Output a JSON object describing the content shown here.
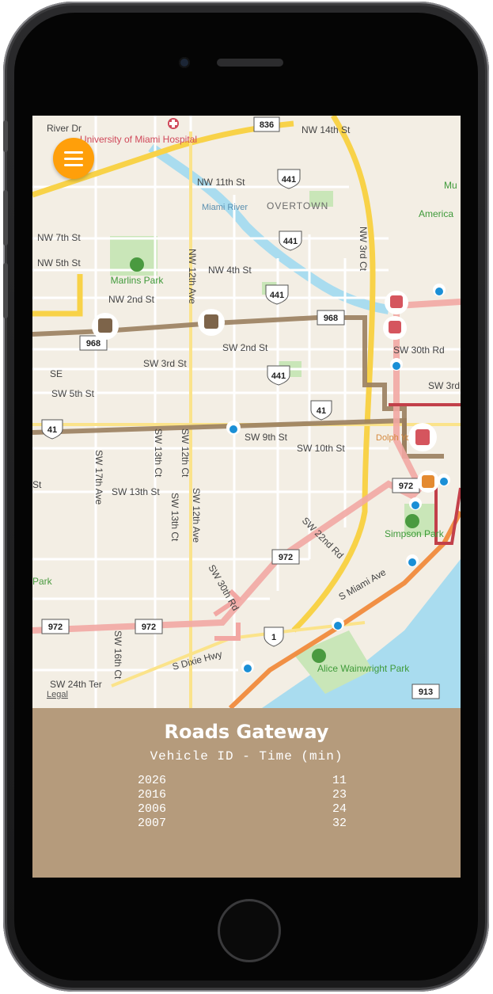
{
  "map": {
    "street_labels": [
      "NW 14th St",
      "NW 11th St",
      "OVERTOWN",
      "Miami River",
      "NW 7th St",
      "NW 5th St",
      "NW 4th St",
      "NW 2nd St",
      "SW 2nd St",
      "SW 3rd St",
      "SW 5th St",
      "SW 9th St",
      "SW 10th St",
      "SW 13th St",
      "NW 3rd Ct",
      "NW 12th Ave",
      "SW 17th Ave",
      "SW 13th Ct",
      "SW 12th Ct",
      "SW 12th Ave",
      "SW 30th Rd",
      "SW 22nd Rd",
      "S Miami Ave",
      "S Dixie Hwy",
      "SW 16th Ct",
      "SW 24th Ter",
      "SW 3rd St",
      "SE",
      "River Dr",
      "St",
      "Park"
    ],
    "places": [
      "University of Miami Hospital",
      "Marlins Park",
      "Simpson Park",
      "Alice Wainwright Park",
      "Dolph Your Ca",
      "America",
      "Mu",
      "Legal"
    ],
    "shields": [
      "836",
      "441",
      "441",
      "441",
      "441",
      "968",
      "968",
      "41",
      "41",
      "972",
      "972",
      "972",
      "972",
      "1",
      "913"
    ],
    "legal": "Legal"
  },
  "menu": {
    "icon": "hamburger-menu-icon"
  },
  "panel": {
    "title": "Roads Gateway",
    "subtitle": "Vehicle ID - Time (min)",
    "rows": [
      {
        "id": "2026",
        "time": "11"
      },
      {
        "id": "2016",
        "time": "23"
      },
      {
        "id": "2006",
        "time": "24"
      },
      {
        "id": "2007",
        "time": "32"
      }
    ]
  },
  "colors": {
    "accent": "#ff9f0a",
    "panel": "#b59b7c",
    "route_brown": "#9a7e5e",
    "route_pink": "#f2a7a3",
    "route_orange": "#f08a3c",
    "water": "#a9dcef"
  }
}
